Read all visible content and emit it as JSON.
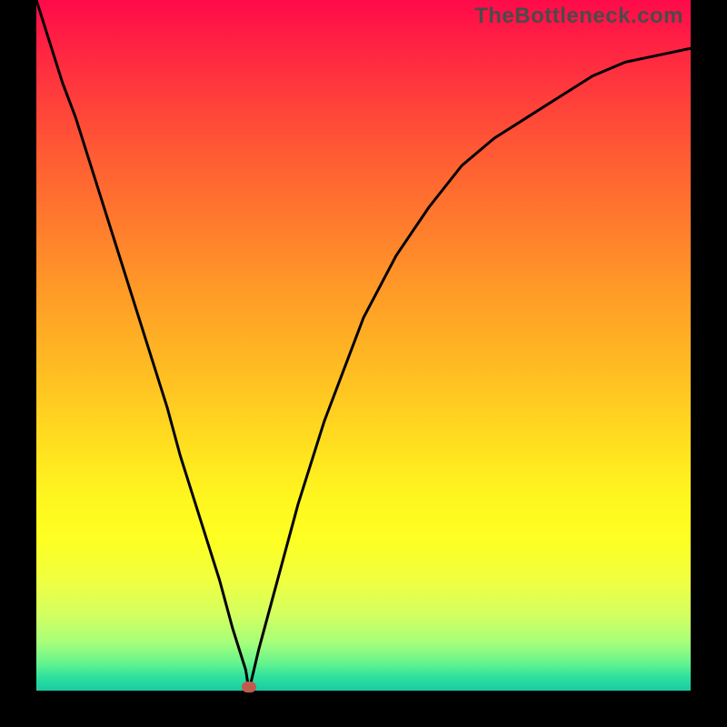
{
  "watermark": "TheBottleneck.com",
  "marker": {
    "x_frac": 0.325,
    "y_frac": 0.995
  },
  "colors": {
    "curve": "#000000",
    "marker": "#c05a4d",
    "gradient_top": "#ff0a4a",
    "gradient_bottom": "#18cba0",
    "frame": "#000000"
  },
  "chart_data": {
    "type": "line",
    "title": "",
    "xlabel": "",
    "ylabel": "",
    "xlim": [
      0,
      1
    ],
    "ylim": [
      0,
      1
    ],
    "legend": false,
    "grid": false,
    "series": [
      {
        "name": "bottleneck-curve",
        "x": [
          0.0,
          0.02,
          0.04,
          0.06,
          0.08,
          0.1,
          0.12,
          0.14,
          0.16,
          0.18,
          0.2,
          0.22,
          0.24,
          0.26,
          0.28,
          0.3,
          0.31,
          0.32,
          0.325,
          0.33,
          0.34,
          0.36,
          0.38,
          0.4,
          0.42,
          0.44,
          0.46,
          0.48,
          0.5,
          0.55,
          0.6,
          0.65,
          0.7,
          0.75,
          0.8,
          0.85,
          0.9,
          0.95,
          1.0
        ],
        "y": [
          1.0,
          0.94,
          0.88,
          0.83,
          0.77,
          0.71,
          0.65,
          0.59,
          0.53,
          0.47,
          0.41,
          0.34,
          0.28,
          0.22,
          0.16,
          0.09,
          0.06,
          0.03,
          0.0,
          0.02,
          0.06,
          0.13,
          0.2,
          0.27,
          0.33,
          0.39,
          0.44,
          0.49,
          0.54,
          0.63,
          0.7,
          0.76,
          0.8,
          0.83,
          0.86,
          0.89,
          0.91,
          0.92,
          0.93
        ]
      }
    ],
    "annotations": [
      {
        "name": "min-marker",
        "x": 0.325,
        "y": 0.0
      }
    ]
  }
}
